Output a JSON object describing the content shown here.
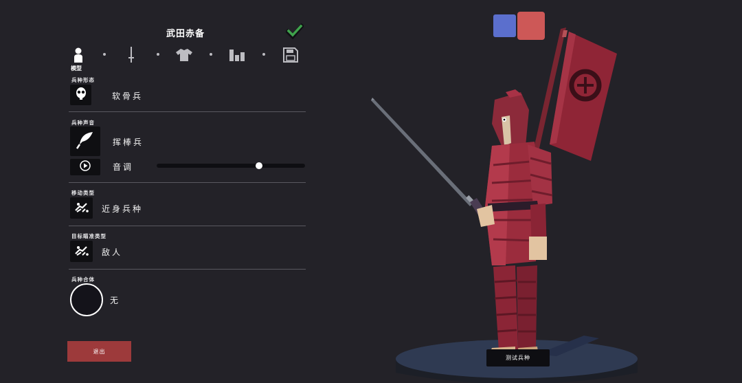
{
  "panel": {
    "title": "武田赤备",
    "tabs": [
      {
        "icon": "person-icon",
        "label": "模型"
      },
      {
        "icon": "sword-icon"
      },
      {
        "icon": "shirt-icon"
      },
      {
        "icon": "bar-chart-icon"
      },
      {
        "icon": "save-icon"
      }
    ]
  },
  "sections": {
    "unit_form": {
      "label": "兵种形态",
      "icon": "skull-icon",
      "value": "软骨兵"
    },
    "unit_voice": {
      "label": "兵种声音",
      "icon": "feather-icon",
      "value": "挥棒兵",
      "pitch_label": "音调",
      "pitch_level": 0.7
    },
    "movement": {
      "label": "移动类型",
      "icon": "unit-move-icon",
      "value": "近身兵种"
    },
    "targeting": {
      "label": "目标瞄准类型",
      "icon": "unit-target-icon",
      "value": "敌人"
    },
    "merge": {
      "label": "兵种合体",
      "value": "无"
    }
  },
  "buttons": {
    "exit": "退出",
    "test_unit": "测试兵种"
  },
  "colors": {
    "team_blue": "#5b6fcd",
    "team_red": "#cd5857",
    "exit_button": "#9d3a3b",
    "background": "#232228",
    "check": "#3fa24c"
  }
}
